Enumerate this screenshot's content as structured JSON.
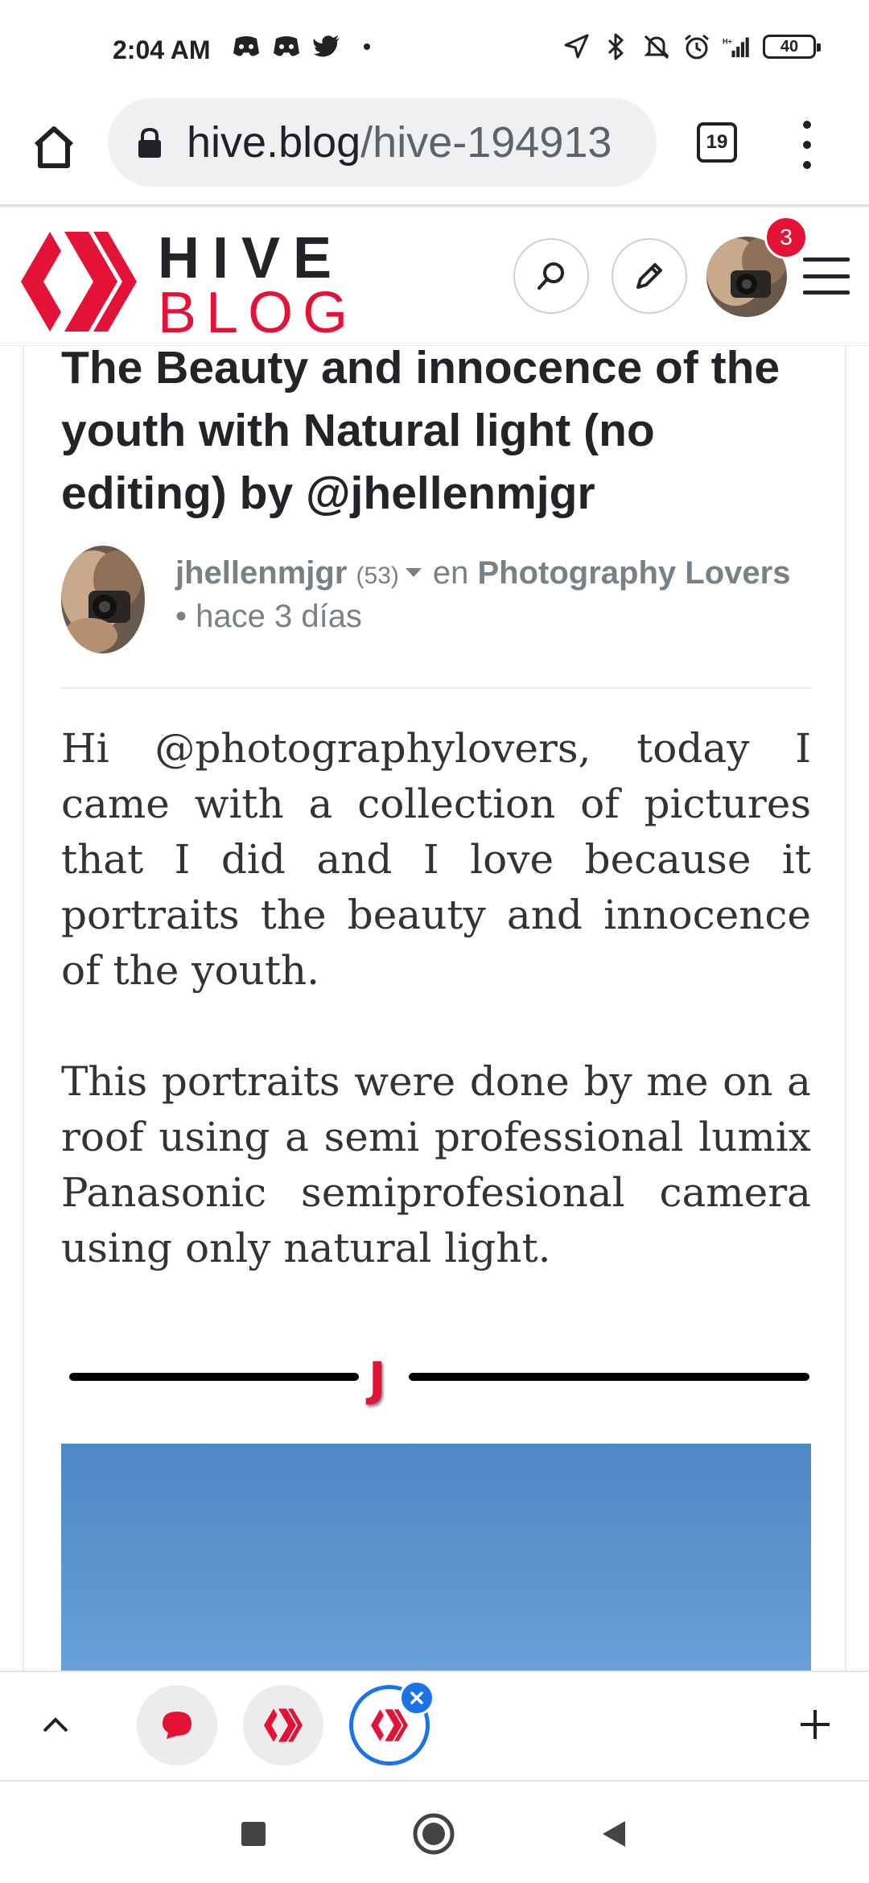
{
  "status_bar": {
    "time": "2:04 AM",
    "battery": "40",
    "left_icons": [
      "discord-icon",
      "discord-icon",
      "twitter-icon",
      "dot-icon"
    ],
    "right_icons": [
      "location-icon",
      "bluetooth-icon",
      "mute-icon",
      "alarm-icon",
      "signal-icon",
      "battery-icon"
    ]
  },
  "browser": {
    "url_host": "hive.blog",
    "url_path": "/hive-194913",
    "tab_count": "19"
  },
  "site_header": {
    "logo_line1": "HIVE",
    "logo_line2": "BLOG",
    "notification_count": "3",
    "brand_color": "#e31337"
  },
  "post": {
    "title": "The Beauty and innocence of the youth with Natural light (no editing) by @jhellenmjgr",
    "author": "jhellenmjgr",
    "reputation": "(53)",
    "in_label": "en",
    "community": "Photography Lovers",
    "time_ago": "• hace 3 días",
    "paragraphs": [
      "Hi @photographylovers, today I came with a collection of pictures that I did and I love because it portraits the beauty and innocence of the youth.",
      "This portraits were done by me on a roof using a semi professional lumix Panasonic semiprofesional camera using only natural light."
    ],
    "separator_letter": "J"
  },
  "bottom_toolbar": {
    "tabs": [
      "chat-tab",
      "hive-tab",
      "hive-tab-active"
    ],
    "accent_color": "#1a73e8"
  }
}
